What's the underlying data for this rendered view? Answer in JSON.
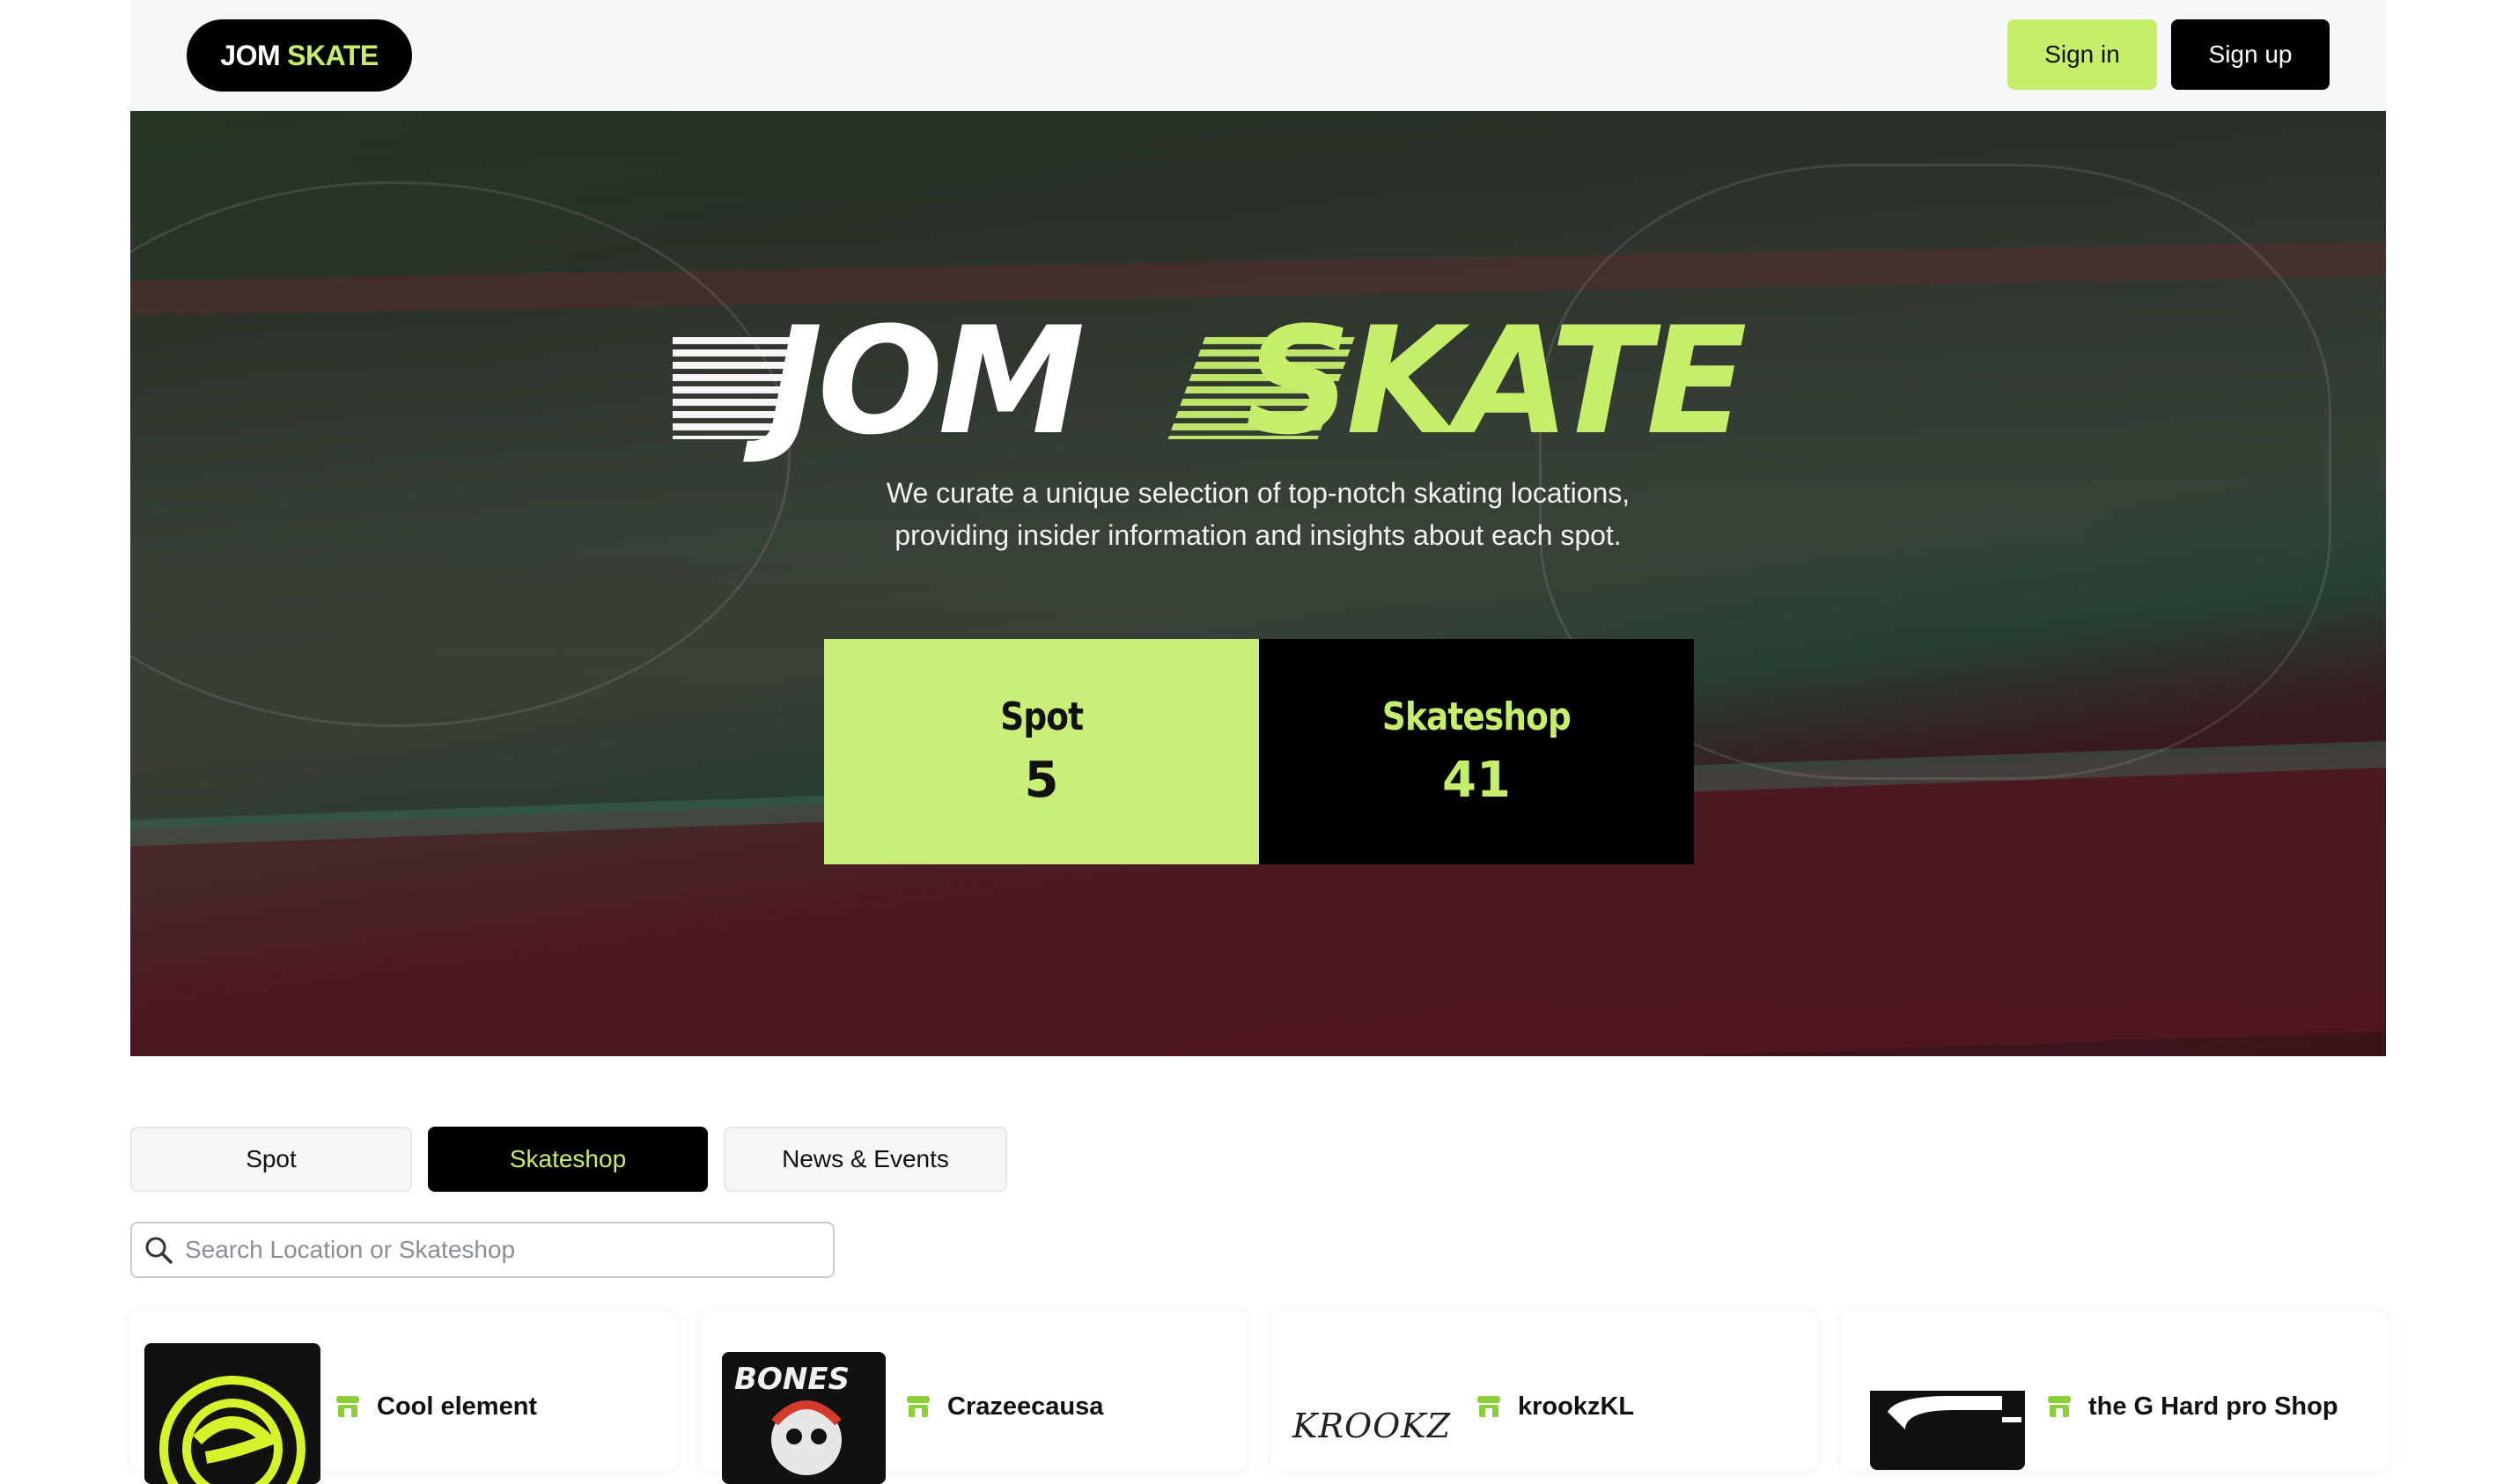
{
  "navbar": {
    "brand_primary": "JOM",
    "brand_accent": "SKATE",
    "signin_label": "Sign in",
    "signup_label": "Sign up"
  },
  "hero": {
    "logo_primary": "JOM",
    "logo_accent": "SKATE",
    "tagline_line1": "We curate a unique selection of top-notch skating locations,",
    "tagline_line2": "providing insider information and insights about each spot.",
    "stats": [
      {
        "label": "Spot",
        "value": "5"
      },
      {
        "label": "Skateshop",
        "value": "41"
      }
    ]
  },
  "tabs": [
    {
      "label": "Spot",
      "active": false
    },
    {
      "label": "Skateshop",
      "active": true
    },
    {
      "label": "News & Events",
      "active": false
    }
  ],
  "search": {
    "placeholder": "Search Location or Skateshop",
    "value": ""
  },
  "shops": [
    {
      "name": "Cool element",
      "logo": "cool-element-logo"
    },
    {
      "name": "Crazeecausa",
      "logo": "bones-logo"
    },
    {
      "name": "krookzKL",
      "logo": "krookz-logo",
      "logo_text": "KROOKZ"
    },
    {
      "name": "the G Hard pro Shop",
      "logo": "g-hard-logo"
    }
  ],
  "colors": {
    "accent": "#c5ee6b",
    "dark": "#000000",
    "spot_card": "#c9ef7a",
    "location_pin": "#e04646"
  }
}
